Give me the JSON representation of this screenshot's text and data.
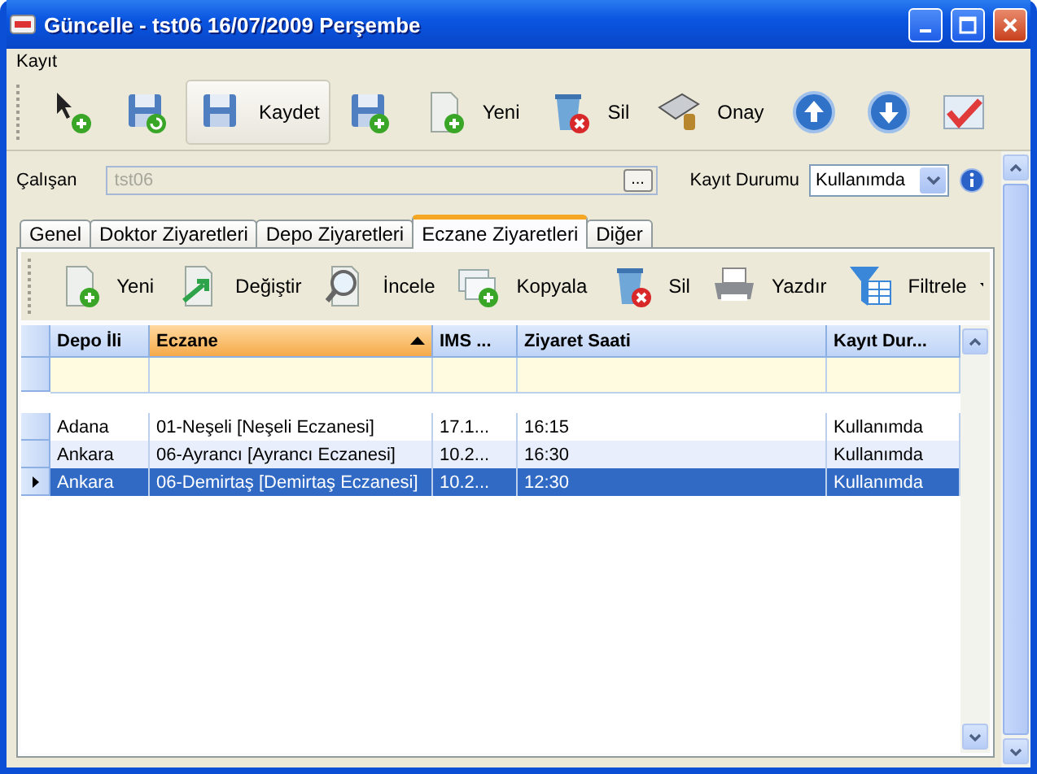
{
  "window": {
    "title": "Güncelle - tst06 16/07/2009 Perşembe"
  },
  "menu": [
    "Kayıt"
  ],
  "toolbar": [
    {
      "highlighted": false
    },
    {
      "highlighted": false
    },
    {
      "label": "Kaydet",
      "highlighted": true
    },
    {
      "highlighted": false
    },
    {
      "label": "Yeni",
      "highlighted": false
    },
    {
      "label": "Sil",
      "highlighted": false
    },
    {
      "label": "Onay",
      "highlighted": false
    },
    {
      "highlighted": false
    },
    {
      "highlighted": false
    },
    {
      "highlighted": false
    }
  ],
  "form": {
    "employee_label": "Çalışan",
    "employee_value": "tst06",
    "employee_disabled": true,
    "browse_button": "...",
    "status_label": "Kayıt Durumu",
    "status_value": "Kullanımda"
  },
  "tabs": [
    {
      "label": "Genel",
      "selected": false
    },
    {
      "label": "Doktor Ziyaretleri",
      "selected": false
    },
    {
      "label": "Depo Ziyaretleri",
      "selected": false
    },
    {
      "label": "Eczane Ziyaretleri",
      "selected": true
    },
    {
      "label": "Diğer",
      "selected": false
    }
  ],
  "tab_toolbar": [
    {
      "label": "Yeni"
    },
    {
      "label": "Değiştir"
    },
    {
      "label": "İncele"
    },
    {
      "label": "Kopyala"
    },
    {
      "label": "Sil"
    },
    {
      "label": "Yazdır"
    },
    {
      "label": "Filtrele",
      "dropdown": true
    }
  ],
  "table": {
    "columns": [
      {
        "label": "Depo İli",
        "sorted": false
      },
      {
        "label": "Eczane",
        "sorted": true
      },
      {
        "label": "IMS ...",
        "sorted": false
      },
      {
        "label": "Ziyaret Saati",
        "sorted": false
      },
      {
        "label": "Kayıt Dur...",
        "sorted": false
      }
    ],
    "rows": [
      {
        "cells": [
          "Adana",
          "01-Neşeli [Neşeli Eczanesi]",
          "17.1...",
          "16:15",
          "Kullanımda"
        ],
        "selected": false
      },
      {
        "cells": [
          "Ankara",
          "06-Ayrancı [Ayrancı Eczanesi]",
          "10.2...",
          "16:30",
          "Kullanımda"
        ],
        "selected": false
      },
      {
        "cells": [
          "Ankara",
          "06-Demirtaş [Demirtaş Eczanesi]",
          "10.2...",
          "12:30",
          "Kullanımda"
        ],
        "selected": true
      }
    ]
  }
}
